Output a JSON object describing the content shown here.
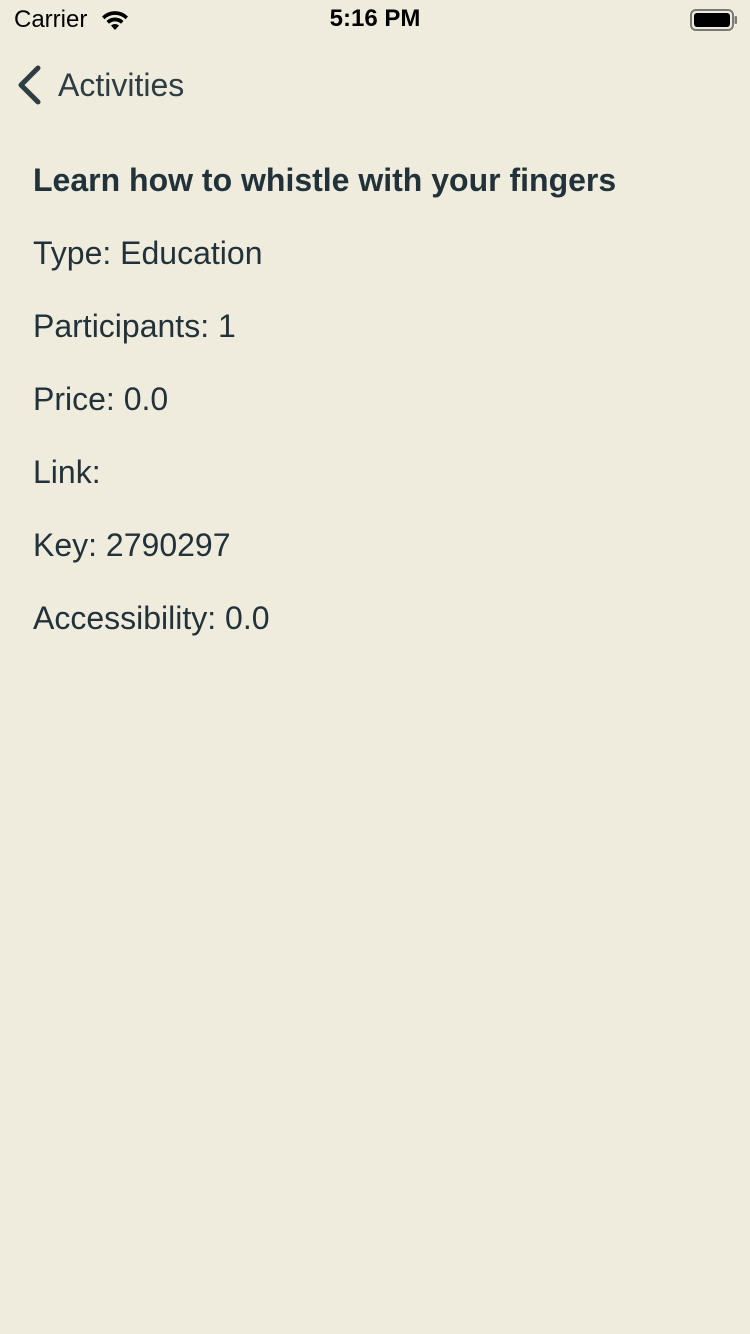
{
  "status_bar": {
    "carrier": "Carrier",
    "time": "5:16 PM",
    "wifi_icon": "wifi-icon",
    "battery_icon": "battery-icon"
  },
  "nav": {
    "back_label": "Activities",
    "back_icon": "chevron-left-icon"
  },
  "activity": {
    "title": "Learn how to whistle with your fingers",
    "type": "Type: Education",
    "participants": "Participants: 1",
    "price": "Price: 0.0",
    "link": "Link:",
    "key": "Key: 2790297",
    "accessibility": "Accessibility: 0.0"
  },
  "colors": {
    "background": "#EFECDE",
    "text": "#22323A"
  }
}
